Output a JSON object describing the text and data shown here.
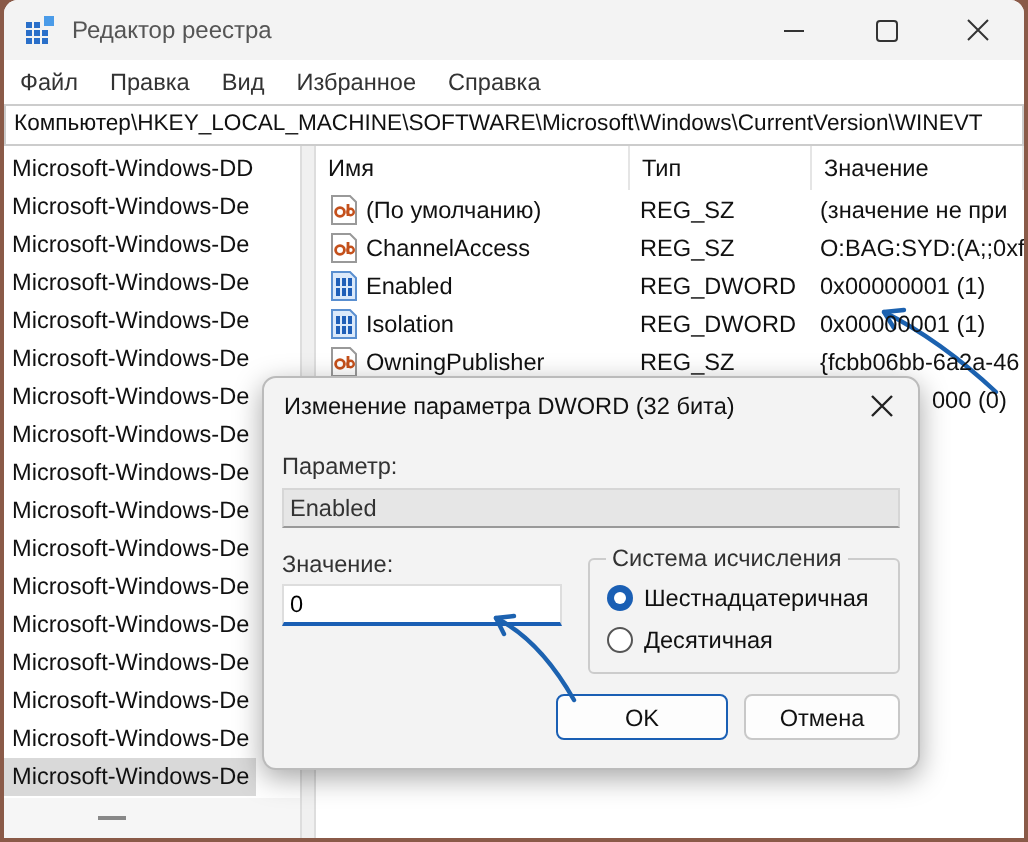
{
  "window": {
    "title": "Редактор реестра"
  },
  "menu": [
    "Файл",
    "Правка",
    "Вид",
    "Избранное",
    "Справка"
  ],
  "address": "Компьютер\\HKEY_LOCAL_MACHINE\\SOFTWARE\\Microsoft\\Windows\\CurrentVersion\\WINEVT",
  "tree": [
    {
      "label": "Microsoft-Windows-DD",
      "selected": false
    },
    {
      "label": "Microsoft-Windows-De",
      "selected": false
    },
    {
      "label": "Microsoft-Windows-De",
      "selected": false
    },
    {
      "label": "Microsoft-Windows-De",
      "selected": false
    },
    {
      "label": "Microsoft-Windows-De",
      "selected": false
    },
    {
      "label": "Microsoft-Windows-De",
      "selected": false
    },
    {
      "label": "Microsoft-Windows-De",
      "selected": false
    },
    {
      "label": "Microsoft-Windows-De",
      "selected": false
    },
    {
      "label": "Microsoft-Windows-De",
      "selected": false
    },
    {
      "label": "Microsoft-Windows-De",
      "selected": false
    },
    {
      "label": "Microsoft-Windows-De",
      "selected": false
    },
    {
      "label": "Microsoft-Windows-De",
      "selected": false
    },
    {
      "label": "Microsoft-Windows-De",
      "selected": false
    },
    {
      "label": "Microsoft-Windows-De",
      "selected": false
    },
    {
      "label": "Microsoft-Windows-De",
      "selected": false
    },
    {
      "label": "Microsoft-Windows-De",
      "selected": false
    },
    {
      "label": "Microsoft-Windows-De",
      "selected": true
    }
  ],
  "table": {
    "columns": [
      "Имя",
      "Тип",
      "Значение"
    ],
    "rows": [
      {
        "kind": "string",
        "name": "(По умолчанию)",
        "type": "REG_SZ",
        "value": "(значение не при"
      },
      {
        "kind": "string",
        "name": "ChannelAccess",
        "type": "REG_SZ",
        "value": "O:BAG:SYD:(A;;0xf"
      },
      {
        "kind": "dword",
        "name": "Enabled",
        "type": "REG_DWORD",
        "value": "0x00000001 (1)"
      },
      {
        "kind": "dword",
        "name": "Isolation",
        "type": "REG_DWORD",
        "value": "0x00000001 (1)"
      },
      {
        "kind": "string",
        "name": "OwningPublisher",
        "type": "REG_SZ",
        "value": "{fcbb06bb-6a2a-46"
      },
      {
        "kind": "hidden",
        "value": "000 (0)"
      }
    ]
  },
  "dialog": {
    "title": "Изменение параметра DWORD (32 бита)",
    "name_label": "Параметр:",
    "name_value": "Enabled",
    "value_label": "Значение:",
    "value": "0",
    "base_group": "Система исчисления",
    "bases": [
      {
        "label": "Шестнадцатеричная",
        "selected": true
      },
      {
        "label": "Десятичная",
        "selected": false
      }
    ],
    "buttons": [
      {
        "label": "OK",
        "default": true
      },
      {
        "label": "Отмена",
        "default": false
      }
    ]
  }
}
